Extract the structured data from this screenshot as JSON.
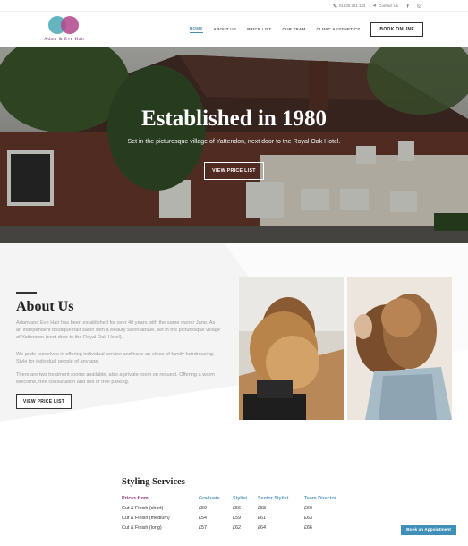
{
  "topbar": {
    "phone": "01635 201 133",
    "contact": "Contact Us"
  },
  "logo": {
    "text": "Adam & Eve Hair"
  },
  "nav": {
    "items": [
      {
        "label": "HOME"
      },
      {
        "label": "ABOUT US"
      },
      {
        "label": "PRICE LIST"
      },
      {
        "label": "OUR TEAM"
      },
      {
        "label": "CLINIC AESTHETICS"
      }
    ],
    "book_label": "BOOK ONLINE"
  },
  "hero": {
    "title": "Established in 1980",
    "subtitle": "Set in the picturesque village of Yattendon, next door to the Royal Oak Hotel.",
    "button": "VIEW PRICE LIST"
  },
  "about": {
    "title": "About Us",
    "paragraphs": [
      "Adam and Eve Hair has been established for over 40 years with the same owner Jane. As an independent boutique hair salon with a Beauty salon above, set in the picturesque village of Yattendon (next door to the Royal Oak Hotel).",
      "We pride ourselves in offering individual service and have an ethos of family hairdressing. Style for individual people of any age.",
      "There are two treatment rooms available, also a private room on request. Offering a warm welcome, free consultation and lots of free parking."
    ],
    "button": "VIEW PRICE LIST"
  },
  "services": {
    "title": "Styling Services",
    "headers": [
      "Prices from",
      "Graduate",
      "Stylist",
      "Senior Stylist",
      "Team Director"
    ],
    "rows": [
      [
        "Cut & Finish (short)",
        "£50",
        "£56",
        "£58",
        "£60"
      ],
      [
        "Cut & Finish (medium)",
        "£54",
        "£59",
        "£61",
        "£63"
      ],
      [
        "Cut & Finish (long)",
        "£57",
        "£62",
        "£64",
        "£66"
      ]
    ]
  },
  "floating": {
    "appointment_label": "Book an Appointment"
  },
  "colors": {
    "accent_blue": "#4b8ca8",
    "accent_purple": "#9b3a87",
    "logo_teal": "#4aa8b5",
    "logo_magenta": "#b1458c"
  }
}
